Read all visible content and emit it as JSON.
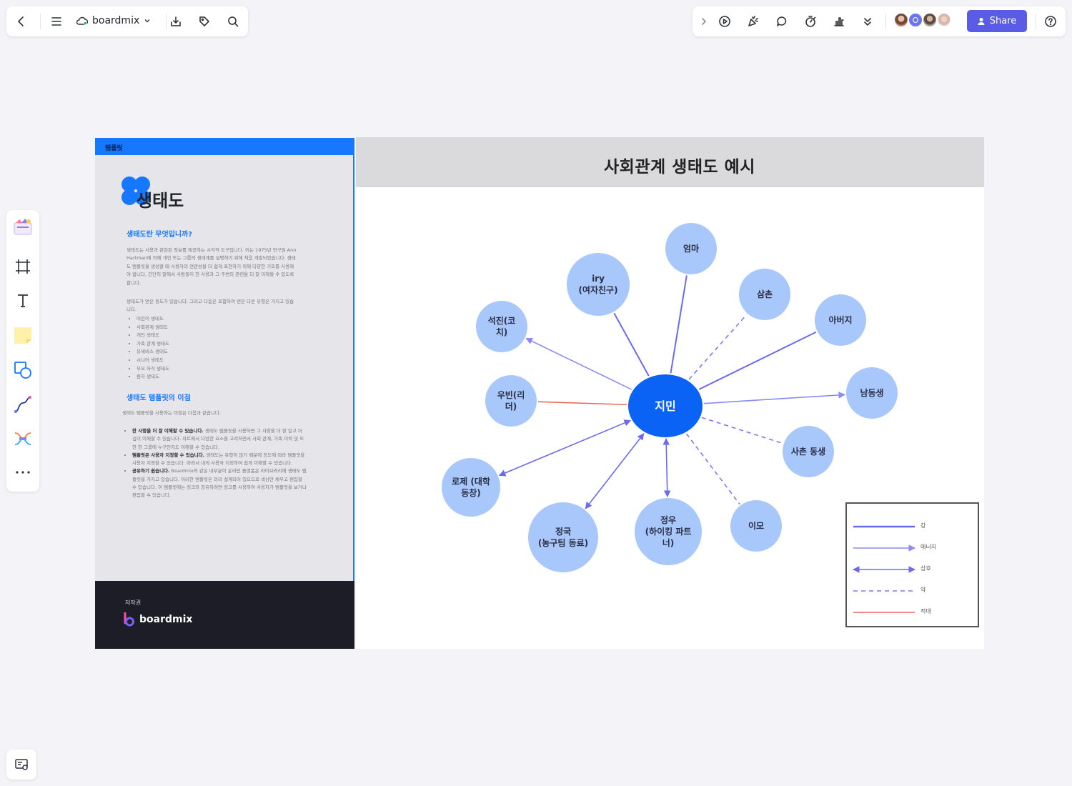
{
  "app": {
    "name": "boardmix",
    "share_label": "Share",
    "accent_color": "#5b5ce6",
    "avatar_letter": "O",
    "collaborators": [
      "user-avatar-1",
      "user-avatar-o",
      "user-avatar-3",
      "user-avatar-4"
    ]
  },
  "toolbar_left": [
    "back-icon",
    "menu-icon",
    "cloud-icon",
    "chevron-down-icon",
    "download-icon",
    "tag-icon",
    "search-icon"
  ],
  "toolbar_right": [
    "chevron-right-icon",
    "play-icon",
    "celebrate-icon",
    "comment-icon",
    "timer-icon",
    "vote-icon",
    "more-icon",
    "help-icon"
  ],
  "left_tools": [
    "template-icon",
    "frame-icon",
    "text-icon",
    "sticky-note-icon",
    "shape-icon",
    "connector-icon",
    "mindmap-icon",
    "more-tools-icon"
  ],
  "template_panel": {
    "top_label": "템플릿",
    "title": "생태도",
    "heading1": "생태도란 무엇입니까?",
    "para1": "생태도는 사용과 관련된 정보를 제공하는 시각적 도구입니다. 이는 1975년 연구원 Ann Hartman에 의해 개인 또는 그룹의 생태계를 설명하기 위해 처음 개발되었습니다. 생태 도 템플릿을 생성할 때 사용자의 연관성을 더 쉽게 표현하기 위해 다양한 기호를 사용해야 합니다. 간단히 말해서 사람들이 한 사용과 그 주변의 관련을 더 잘 이해할 수 있도록 합니다.",
    "para2": "생태도가 얻은 용도가 있습니다. 그리고 다음은 포함하여 얻은 다른 유형은 거지고 있습니다.",
    "list": [
      "어린이 생태도",
      "사회관계 생태도",
      "개인 생태도",
      "가족 관계 생태도",
      "유세비스 생태도",
      "시니어 생태도",
      "부모 자식 생태도",
      "환자 생태도"
    ],
    "heading2": "생태도 템플릿의 이점",
    "para3": "생태도 템플릿을 사용하는 이점은 다음과 같습니다.",
    "bullets": [
      {
        "bold": "한 사항을 더 잘 이해할 수 있습니다.",
        "text": " 생태도 템플릿을 사용하면 그 사항을 더 잘 알고 더 깊이 이해할 수 있습니다. 차트에서 다양한 요소을 고려하면서 사회 관계, 가족 이력 및 또한 한 그룹에 누구인지도 이해할 수 있습니다."
      },
      {
        "bold": "템플릿은 사용자 지정할 수 있습니다.",
        "text": " 생태도는 유형이 많기 때문에 정도에 따라 템플릿을 사용자 지정할 수 있습니다. 따라서 내게 사용자 지정하여 쉽게 이해할 수 있습니다."
      },
      {
        "bold": "공유하기 쉽습니다.",
        "text": " Boardmix와 같은 내부분이 온라인 플랫폼은 라이브러리에 생태도 템플릿을 가지고 있습니다. 이러한 템플릿은 미리 설계되어 있으므로 색상만 채우고 편집할 수 있습니다. 이 템플릿에는 링크와 공유하려면 링크를 사용하여 사용자가 템플릿을 보거나 편집할 수 있습니다."
      }
    ],
    "footer_label": "저작권",
    "footer_brand": "boardmix"
  },
  "diagram": {
    "title": "사회관계 생태도 예시",
    "center": "지민",
    "colors": {
      "center": "#0a63f5",
      "node": "#a8c8fb",
      "strong": "#6a6af0",
      "energy": "#8a8cf2",
      "mutual": "#6a6af0",
      "weak": "#7a7aee",
      "hostile": "#e86a5a"
    },
    "nodes": [
      {
        "id": "mom",
        "lines": [
          "엄마"
        ],
        "relation": "strong"
      },
      {
        "id": "iry",
        "lines": [
          "iry",
          "(여자친구)"
        ],
        "relation": "strong"
      },
      {
        "id": "uncle",
        "lines": [
          "삼촌"
        ],
        "relation": "weak"
      },
      {
        "id": "father",
        "lines": [
          "아버지"
        ],
        "relation": "strong"
      },
      {
        "id": "seokjin",
        "lines": [
          "석진(코",
          "치)"
        ],
        "relation": "energy"
      },
      {
        "id": "brother",
        "lines": [
          "남동생"
        ],
        "relation": "energy"
      },
      {
        "id": "ubin",
        "lines": [
          "우빈(리",
          "더)"
        ],
        "relation": "hostile"
      },
      {
        "id": "cousin",
        "lines": [
          "사촌 동생"
        ],
        "relation": "weak"
      },
      {
        "id": "rose",
        "lines": [
          "로제 (대학",
          "동창)"
        ],
        "relation": "mutual"
      },
      {
        "id": "jungkook",
        "lines": [
          "정국",
          "(농구팀 동료)"
        ],
        "relation": "mutual"
      },
      {
        "id": "jungwoo",
        "lines": [
          "정우",
          "(하이킹 파트",
          "너)"
        ],
        "relation": "mutual"
      },
      {
        "id": "aunt",
        "lines": [
          "이모"
        ],
        "relation": "weak"
      }
    ],
    "legend": [
      {
        "type": "strong",
        "label": "강"
      },
      {
        "type": "energy",
        "label": "에너지"
      },
      {
        "type": "mutual",
        "label": "상호"
      },
      {
        "type": "weak",
        "label": "약"
      },
      {
        "type": "hostile",
        "label": "적대"
      }
    ]
  }
}
